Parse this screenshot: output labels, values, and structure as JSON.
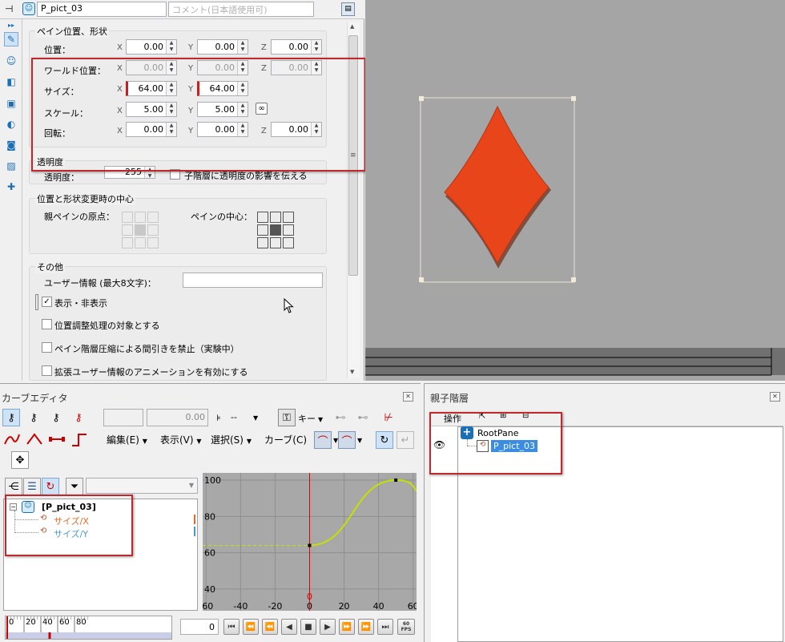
{
  "toolbar": {
    "name_value": "P_pict_03",
    "comment_placeholder": "コメント(日本語使用可)"
  },
  "pane_group": {
    "title": "ペイン位置、形状",
    "position": {
      "label": "位置：",
      "x": "0.00",
      "y": "0.00",
      "z": "0.00"
    },
    "world_position": {
      "label": "ワールド位置：",
      "x": "0.00",
      "y": "0.00",
      "z": "0.00"
    },
    "size": {
      "label": "サイズ：",
      "x": "64.00",
      "y": "64.00"
    },
    "scale": {
      "label": "スケール：",
      "x": "5.00",
      "y": "5.00"
    },
    "rotate": {
      "label": "回転：",
      "x": "0.00",
      "y": "0.00",
      "z": "0.00"
    },
    "axes": {
      "x": "X",
      "y": "Y",
      "z": "Z"
    }
  },
  "alpha_group": {
    "title": "透明度",
    "label": "透明度：",
    "value": "255",
    "check_label": "子階層に透明度の影響を伝える"
  },
  "center_group": {
    "title": "位置と形状変更時の中心",
    "parent_origin": "親ペインの原点：",
    "pane_center": "ペインの中心："
  },
  "other_group": {
    "title": "その他",
    "user_info_label": "ユーザー情報 (最大8文字)：",
    "visible_label": "表示・非表示",
    "adjust_label": "位置調整処理の対象とする",
    "cull_label": "ペイン階層圧縮による間引きを禁止（実験中）",
    "ext_anim_label": "拡張ユーザー情報のアニメーションを有効にする"
  },
  "curve_editor": {
    "title": "カーブエディタ",
    "value_field": "0.00",
    "dropdown": "--",
    "key_label": "キー",
    "menus": [
      "編集(E)",
      "表示(V)",
      "選択(S)",
      "カーブ(C)"
    ],
    "tree": {
      "root": "[P_pict_03]",
      "item_x": "サイズ/X",
      "item_y": "サイズ/Y"
    },
    "frame_value": "0",
    "fps_label": "60 FPS",
    "ruler_ticks": [
      "0",
      "20",
      "40",
      "60",
      "80"
    ]
  },
  "hierarchy": {
    "title": "親子階層",
    "menu_label": "操作",
    "root": "RootPane",
    "child": "P_pict_03"
  },
  "chart_data": {
    "type": "line",
    "x_ticks": [
      "-60",
      "-40",
      "-20",
      "0",
      "20",
      "40",
      "60"
    ],
    "y_ticks": [
      "100",
      "80",
      "60",
      "40"
    ],
    "current_frame_label": "0",
    "keys": [
      {
        "x": 0,
        "y": 64
      },
      {
        "x": 50,
        "y": 100
      }
    ],
    "xlim": [
      -62,
      62
    ],
    "ylim": [
      28,
      104
    ]
  },
  "colors": {
    "accent_red": "#c0282d",
    "diamond": "#e8461a",
    "curve": "#c6e000"
  }
}
